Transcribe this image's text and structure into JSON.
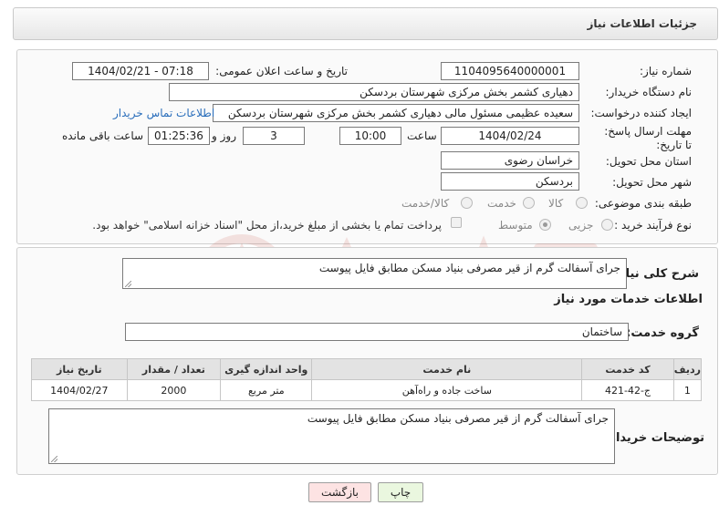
{
  "header": {
    "title": "جزئیات اطلاعات نیاز"
  },
  "labels": {
    "need_number": "شماره نیاز:",
    "announce_datetime": "تاریخ و ساعت اعلان عمومی:",
    "buyer_org": "نام دستگاه خریدار:",
    "requester": "ایجاد کننده درخواست:",
    "buyer_contact": "اطلاعات تماس خریدار",
    "deadline": "مهلت ارسال پاسخ: تا تاریخ:",
    "time": "ساعت",
    "day_and": "روز و",
    "remaining": "ساعت باقی مانده",
    "province": "استان محل تحویل:",
    "city": "شهر محل تحویل:",
    "category": "طبقه بندی موضوعی:",
    "purchase_type": "نوع فرآیند خرید :",
    "general_desc": "شرح کلی نیاز:",
    "services_title": "اطلاعات خدمات مورد نیاز",
    "service_group": "گروه خدمت:",
    "buyer_notes": "توضیحات خریدار:"
  },
  "values": {
    "need_number": "1104095640000001",
    "announce_datetime": "1404/02/21 - 07:18",
    "buyer_org": "دهیاری کشمر بخش مرکزی شهرستان بردسکن",
    "requester": "سعیده عظیمی مسئول مالی دهیاری کشمر بخش مرکزی شهرستان بردسکن",
    "deadline_date": "1404/02/24",
    "deadline_time": "10:00",
    "days": "3",
    "remaining_time": "01:25:36",
    "province": "خراسان رضوی",
    "city": "بردسکن",
    "general_desc": "جرای آسفالت گرم از قیر مصرفی بنیاد مسکن مطابق فایل پیوست",
    "service_group": "ساختمان",
    "buyer_notes": "جرای آسفالت گرم از قیر مصرفی بنیاد مسکن مطابق فایل پیوست"
  },
  "category_options": [
    {
      "label": "کالا",
      "selected": false
    },
    {
      "label": "خدمت",
      "selected": false
    },
    {
      "label": "کالا/خدمت",
      "selected": false
    }
  ],
  "purchase_options": [
    {
      "label": "جزیی",
      "selected": false
    },
    {
      "label": "متوسط",
      "selected": true
    }
  ],
  "treasury_note": "پرداخت تمام یا بخشی از مبلغ خرید،از محل \"اسناد خزانه اسلامی\" خواهد بود.",
  "table": {
    "headers": [
      "ردیف",
      "کد خدمت",
      "نام خدمت",
      "واحد اندازه گیری",
      "تعداد / مقدار",
      "تاریخ نیاز"
    ],
    "rows": [
      [
        "1",
        "ج-42-421",
        "ساخت جاده و راه‌آهن",
        "متر مربع",
        "2000",
        "1404/02/27"
      ]
    ]
  },
  "buttons": {
    "print": "چاپ",
    "back": "بازگشت"
  },
  "colors": {
    "link": "#2a6ebb",
    "back_button_bg": "#fde3e3",
    "print_button_bg": "#eaf7df",
    "watermark": "#c0392b"
  }
}
